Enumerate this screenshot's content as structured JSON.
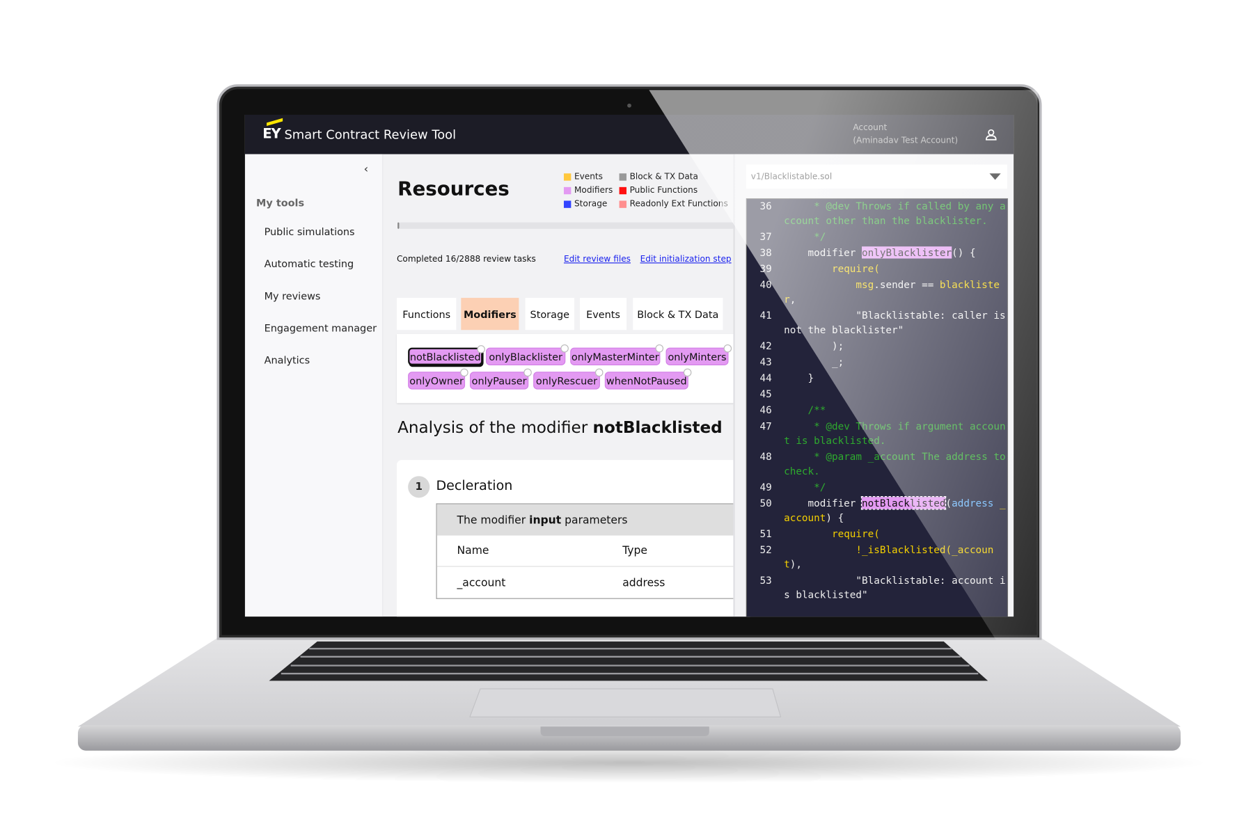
{
  "app": {
    "logo": "EY",
    "title": "Smart Contract Review Tool",
    "account_label": "Account",
    "account_name": "(Aminadav Test Account)"
  },
  "sidebar": {
    "collapse": "‹",
    "section": "My tools",
    "items": [
      {
        "label": "Public simulations"
      },
      {
        "label": "Automatic testing"
      },
      {
        "label": "My reviews"
      },
      {
        "label": "Engagement manager"
      },
      {
        "label": "Analytics"
      }
    ]
  },
  "main": {
    "title": "Resources",
    "legend": [
      {
        "label": "Events",
        "color": "#ffc83d"
      },
      {
        "label": "Modifiers",
        "color": "#e39af2"
      },
      {
        "label": "Storage",
        "color": "#3344ff"
      },
      {
        "label": "Block & TX Data",
        "color": "#999999"
      },
      {
        "label": "Public Functions",
        "color": "#ff1010"
      },
      {
        "label": "Readonly Ext Functions",
        "color": "#ff8f8f"
      }
    ],
    "progress": {
      "completed": 16,
      "total": 2888,
      "label": "Completed 16/2888 review tasks"
    },
    "links": {
      "edit_files": "Edit review files",
      "edit_init": "Edit initialization step"
    },
    "tabs": [
      {
        "label": "Functions"
      },
      {
        "label": "Modifiers",
        "active": true
      },
      {
        "label": "Storage"
      },
      {
        "label": "Events"
      },
      {
        "label": "Block & TX Data"
      }
    ],
    "chips": [
      {
        "label": "notBlacklisted",
        "selected": true
      },
      {
        "label": "onlyBlacklister"
      },
      {
        "label": "onlyMasterMinter"
      },
      {
        "label": "onlyMinters"
      },
      {
        "label": "onlyOwner"
      },
      {
        "label": "onlyPauser"
      },
      {
        "label": "onlyRescuer"
      },
      {
        "label": "whenNotPaused"
      }
    ],
    "analysis": {
      "prefix": "Analysis of the modifier ",
      "name": "notBlacklisted"
    },
    "step": {
      "number": "1",
      "title": "Decleration",
      "table_caption_pre": "The modifier ",
      "table_caption_bold": "input",
      "table_caption_post": " parameters",
      "columns": [
        "Name",
        "Type"
      ],
      "rows": [
        [
          "_account",
          "address"
        ]
      ]
    }
  },
  "code": {
    "file": "v1/Blacklistable.sol",
    "lines": [
      {
        "n": "36",
        "s": [
          [
            "cm",
            "     * @dev Throws if called by any account other than the blacklister."
          ]
        ]
      },
      {
        "n": "37",
        "s": [
          [
            "cm",
            "     */"
          ]
        ]
      },
      {
        "n": "38",
        "s": [
          [
            "kw",
            "    modifier "
          ],
          [
            "hl",
            "onlyBlacklister"
          ],
          [
            "kw",
            "() {"
          ]
        ]
      },
      {
        "n": "39",
        "s": [
          [
            "y",
            "        require("
          ]
        ]
      },
      {
        "n": "40",
        "s": [
          [
            "y",
            "            msg"
          ],
          [
            "kw",
            ".sender == "
          ],
          [
            "y",
            "blacklister"
          ],
          [
            "kw",
            ","
          ]
        ]
      },
      {
        "n": "41",
        "s": [
          [
            "s",
            "            \"Blacklistable: caller is not the blacklister\""
          ]
        ]
      },
      {
        "n": "42",
        "s": [
          [
            "kw",
            "        );"
          ]
        ]
      },
      {
        "n": "43",
        "s": [
          [
            "kw",
            "        _;"
          ]
        ]
      },
      {
        "n": "44",
        "s": [
          [
            "kw",
            "    }"
          ]
        ]
      },
      {
        "n": "45",
        "s": [
          [
            "kw",
            ""
          ]
        ]
      },
      {
        "n": "46",
        "s": [
          [
            "cm",
            "    /**"
          ]
        ]
      },
      {
        "n": "47",
        "s": [
          [
            "cm",
            "     * @dev Throws if argument account is blacklisted."
          ]
        ]
      },
      {
        "n": "48",
        "s": [
          [
            "cm",
            "     * @param _account The address to check."
          ]
        ]
      },
      {
        "n": "49",
        "s": [
          [
            "cm",
            "     */"
          ]
        ]
      },
      {
        "n": "50",
        "s": [
          [
            "kw",
            "    modifier "
          ],
          [
            "hl2",
            "notBlacklisted"
          ],
          [
            "kw",
            "("
          ],
          [
            "b",
            "address "
          ],
          [
            "y",
            "_account"
          ],
          [
            "kw",
            ") {"
          ]
        ]
      },
      {
        "n": "51",
        "s": [
          [
            "y",
            "        require("
          ]
        ]
      },
      {
        "n": "52",
        "s": [
          [
            "y",
            "            !_isBlacklisted(_account"
          ],
          [
            "kw",
            "),"
          ]
        ]
      },
      {
        "n": "53",
        "s": [
          [
            "s",
            "            \"Blacklistable: account is blacklisted\""
          ]
        ]
      }
    ]
  }
}
